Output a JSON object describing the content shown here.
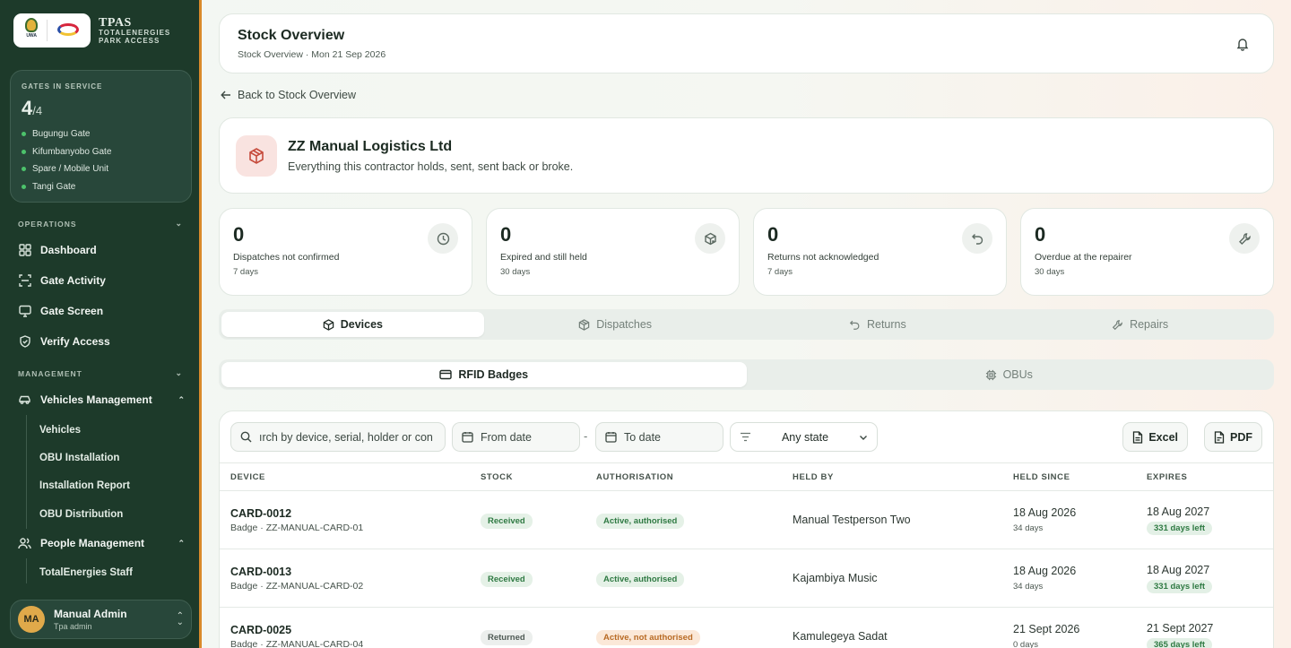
{
  "brand": {
    "logo_a_text": "UWA",
    "title": "TPAS",
    "subtitle_line1": "TOTALENERGIES",
    "subtitle_line2": "PARK ACCESS"
  },
  "gates": {
    "label": "GATES IN SERVICE",
    "count": "4",
    "total": "/4",
    "items": [
      "Bugungu Gate",
      "Kifumbanyobo Gate",
      "Spare / Mobile Unit",
      "Tangi Gate"
    ]
  },
  "sidebar": {
    "operations_label": "OPERATIONS",
    "operations": [
      {
        "label": "Dashboard",
        "icon": "grid-icon"
      },
      {
        "label": "Gate Activity",
        "icon": "scan-icon"
      },
      {
        "label": "Gate Screen",
        "icon": "monitor-icon"
      },
      {
        "label": "Verify Access",
        "icon": "shield-check-icon"
      }
    ],
    "management_label": "MANAGEMENT",
    "vehicles": {
      "label": "Vehicles Management",
      "icon": "car-icon",
      "items": [
        "Vehicles",
        "OBU Installation",
        "Installation Report",
        "OBU Distribution"
      ]
    },
    "people": {
      "label": "People Management",
      "icon": "users-icon",
      "items": [
        "TotalEnergies Staff"
      ]
    }
  },
  "user": {
    "initials": "MA",
    "name": "Manual Admin",
    "role": "Tpa admin"
  },
  "header": {
    "title": "Stock Overview",
    "subtitle": "Stock Overview · Mon 21 Sep 2026"
  },
  "back_link": "Back to Stock Overview",
  "contractor": {
    "name": "ZZ Manual Logistics Ltd",
    "description": "Everything this contractor holds, sent, sent back or broke."
  },
  "stats": [
    {
      "value": "0",
      "label": "Dispatches not confirmed",
      "sub": "7 days",
      "icon": "clock-icon"
    },
    {
      "value": "0",
      "label": "Expired and still held",
      "sub": "30 days",
      "icon": "package-x-icon"
    },
    {
      "value": "0",
      "label": "Returns not acknowledged",
      "sub": "7 days",
      "icon": "undo-icon"
    },
    {
      "value": "0",
      "label": "Overdue at the repairer",
      "sub": "30 days",
      "icon": "wrench-icon"
    }
  ],
  "tabs": [
    {
      "label": "Devices",
      "icon": "box-icon",
      "active": true
    },
    {
      "label": "Dispatches",
      "icon": "package-icon",
      "active": false
    },
    {
      "label": "Returns",
      "icon": "undo-icon",
      "active": false
    },
    {
      "label": "Repairs",
      "icon": "wrench-icon",
      "active": false
    }
  ],
  "subtabs": [
    {
      "label": "RFID Badges",
      "icon": "card-icon",
      "active": true
    },
    {
      "label": "OBUs",
      "icon": "chip-icon",
      "active": false
    }
  ],
  "toolbar": {
    "search_value": "ırch by device, serial, holder or con",
    "from_date": "From date",
    "separator": "-",
    "to_date": "To date",
    "state_filter": "Any state",
    "excel_label": "Excel",
    "pdf_label": "PDF"
  },
  "table": {
    "columns": [
      "DEVICE",
      "STOCK",
      "AUTHORISATION",
      "HELD BY",
      "HELD SINCE",
      "EXPIRES"
    ],
    "rows": [
      {
        "device": "CARD-0012",
        "serial": "Badge · ZZ-MANUAL-CARD-01",
        "stock": "Received",
        "authorisation": "Active, authorised",
        "auth_tone": "green",
        "held_by": "Manual Testperson Two",
        "held_since": "18 Aug 2026",
        "held_days": "34 days",
        "expires": "18 Aug 2027",
        "days_left": "331 days left"
      },
      {
        "device": "CARD-0013",
        "serial": "Badge · ZZ-MANUAL-CARD-02",
        "stock": "Received",
        "authorisation": "Active, authorised",
        "auth_tone": "green",
        "held_by": "Kajambiya Music",
        "held_since": "18 Aug 2026",
        "held_days": "34 days",
        "expires": "18 Aug 2027",
        "days_left": "331 days left"
      },
      {
        "device": "CARD-0025",
        "serial": "Badge · ZZ-MANUAL-CARD-04",
        "stock": "Returned",
        "authorisation": "Active, not authorised",
        "auth_tone": "orange",
        "held_by": "Kamulegeya Sadat",
        "held_since": "21 Sept 2026",
        "held_days": "0 days",
        "expires": "21 Sept 2027",
        "days_left": "365 days left"
      }
    ]
  },
  "colors": {
    "sidebar_bg": "#1d3a2a",
    "accent_orange": "#d98a2b",
    "status_green": "#2f7a43",
    "status_orange": "#b86a24"
  }
}
